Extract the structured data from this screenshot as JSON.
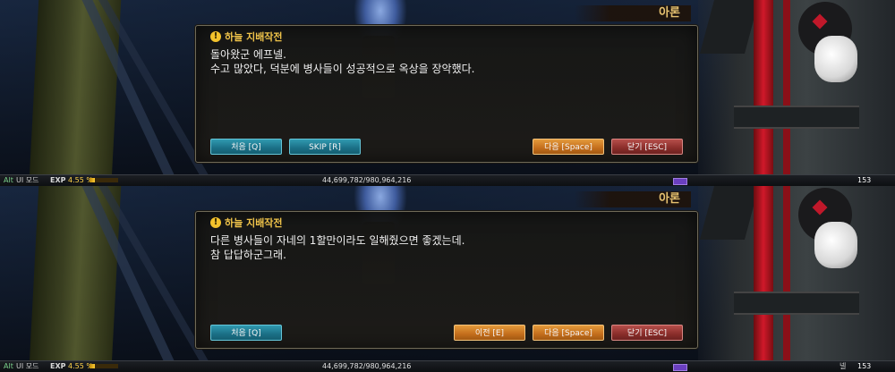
{
  "npc_name": "아론",
  "quest_title": "하늘 지배작전",
  "panels": [
    {
      "lines": [
        "돌아왔군 에프넬.",
        "수고 많았다, 덕분에 병사들이 성공적으로 옥상을 장악했다."
      ],
      "buttons": {
        "first": "처음 [Q]",
        "skip": "SKIP [R]",
        "next": "다음 [Space]",
        "close": "닫기 [ESC]"
      }
    },
    {
      "lines": [
        "다른 병사들이 자네의 1할만이라도 일해줬으면 좋겠는데.",
        "참 답답하군그래."
      ],
      "buttons": {
        "first": "처음 [Q]",
        "prev": "이전 [E]",
        "next": "다음 [Space]",
        "close": "닫기 [ESC]"
      }
    }
  ],
  "status": {
    "auto": "Alt",
    "ui_mode": "UI 모드",
    "exp_label": "EXP",
    "exp_percent": "4.55 %",
    "exp_fraction": 0.0455,
    "exp_value": "44,699,782/980,964,216",
    "level_label_top": "",
    "level_label": "넬",
    "level": "153"
  },
  "colors": {
    "quest_title": "#efc34a",
    "npc_name": "#e6c270",
    "button_teal": "#1b6f86",
    "button_orange": "#c46e1c",
    "button_red": "#8a2d2a"
  }
}
